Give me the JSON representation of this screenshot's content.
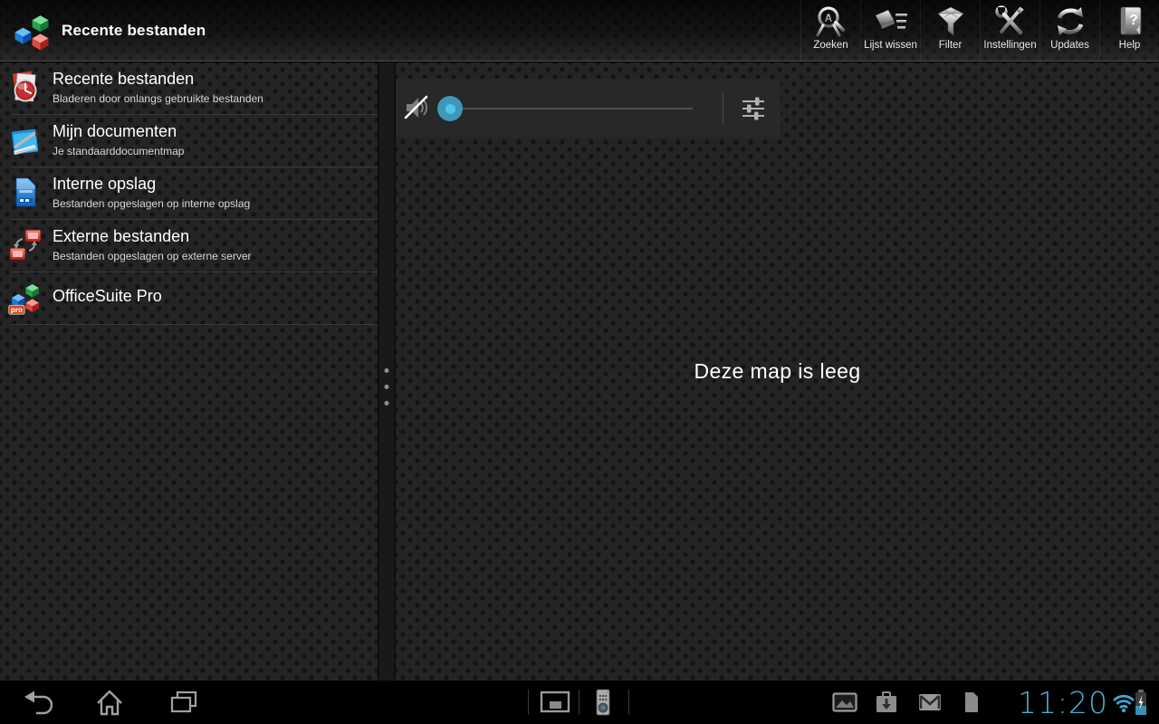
{
  "actionbar": {
    "title": "Recente bestanden",
    "buttons": [
      {
        "label": "Zoeken",
        "icon": "search-icon"
      },
      {
        "label": "Lijst wissen",
        "icon": "clear-list-icon"
      },
      {
        "label": "Filter",
        "icon": "filter-icon"
      },
      {
        "label": "Instellingen",
        "icon": "settings-icon"
      },
      {
        "label": "Updates",
        "icon": "updates-icon"
      },
      {
        "label": "Help",
        "icon": "help-icon"
      }
    ]
  },
  "sidebar": {
    "items": [
      {
        "title": "Recente bestanden",
        "subtitle": "Bladeren door onlangs gebruikte bestanden",
        "icon": "recent-files-icon"
      },
      {
        "title": "Mijn documenten",
        "subtitle": "Je standaarddocumentmap",
        "icon": "my-documents-icon"
      },
      {
        "title": "Interne opslag",
        "subtitle": "Bestanden opgeslagen op interne opslag",
        "icon": "internal-storage-icon"
      },
      {
        "title": "Externe bestanden",
        "subtitle": "Bestanden opgeslagen op externe server",
        "icon": "remote-files-icon"
      },
      {
        "title": "OfficeSuite Pro",
        "subtitle": "",
        "icon": "officesuite-pro-icon",
        "badge": "pro"
      }
    ]
  },
  "content": {
    "empty_message": "Deze map is leeg"
  },
  "volume_popup": {
    "muted": true,
    "value_percent": 0,
    "icons": [
      "volume-muted-icon",
      "audio-settings-icon"
    ]
  },
  "systembar": {
    "clock": "11:20",
    "nav_icons": [
      "back-icon",
      "home-icon",
      "recent-apps-icon"
    ],
    "tray_icons": [
      "screenshot-icon",
      "remote-app-icon"
    ],
    "status_icons": [
      "gallery-icon",
      "download-icon",
      "gmail-icon",
      "notification-page-icon",
      "wifi-icon",
      "battery-charging-icon"
    ]
  },
  "colors": {
    "holo_blue": "#33b5e5",
    "slider_thumb": "#3f97ba",
    "slider_thumb_dot": "#54c4ea",
    "clock_blue": "#4fadd6",
    "surface": "#242424"
  }
}
